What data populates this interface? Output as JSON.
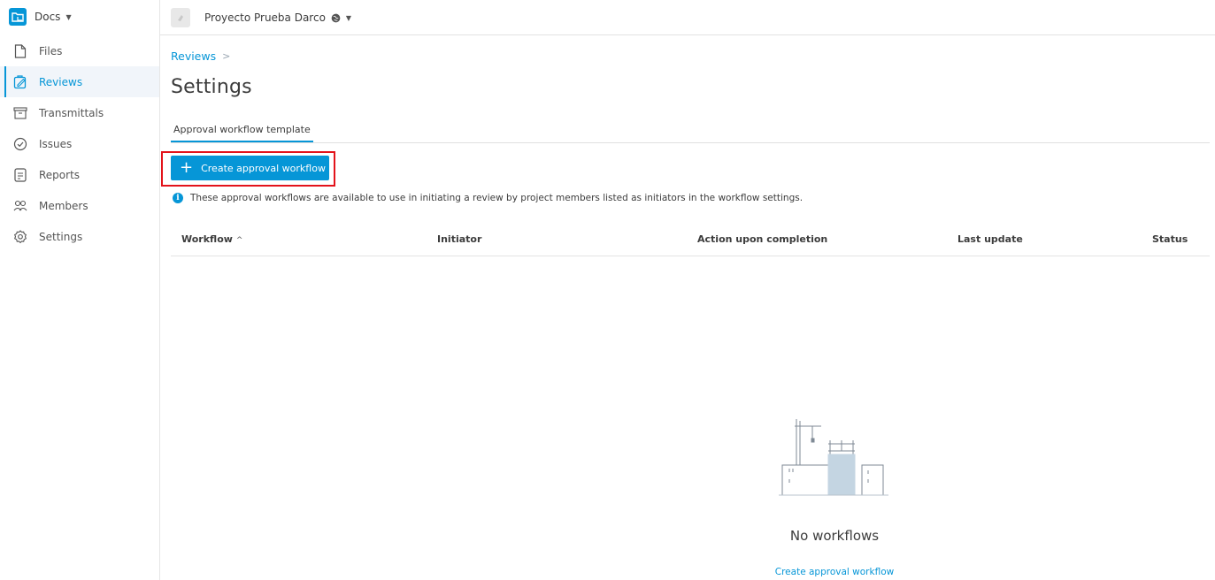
{
  "app": {
    "name": "Docs"
  },
  "project": {
    "name": "Proyecto Prueba Darco"
  },
  "sidebar": {
    "items": [
      {
        "label": "Files",
        "icon": "file-icon"
      },
      {
        "label": "Reviews",
        "icon": "reviews-icon",
        "active": true
      },
      {
        "label": "Transmittals",
        "icon": "transmittals-icon"
      },
      {
        "label": "Issues",
        "icon": "issues-icon"
      },
      {
        "label": "Reports",
        "icon": "reports-icon"
      },
      {
        "label": "Members",
        "icon": "members-icon"
      },
      {
        "label": "Settings",
        "icon": "settings-icon"
      }
    ]
  },
  "breadcrumb": {
    "parent": "Reviews",
    "separator": ">"
  },
  "page": {
    "title": "Settings"
  },
  "tabs": [
    {
      "label": "Approval workflow template",
      "active": true
    }
  ],
  "toolbar": {
    "create_label": "Create approval workflow"
  },
  "info": {
    "text": "These approval workflows are available to use in initiating a review by project members listed as initiators in the workflow settings."
  },
  "table": {
    "columns": [
      "Workflow",
      "Initiator",
      "Action upon completion",
      "Last update",
      "Status"
    ],
    "sort_indicator": "^",
    "rows": []
  },
  "empty_state": {
    "title": "No workflows",
    "link": "Create approval workflow"
  },
  "colors": {
    "accent": "#0696d7",
    "highlight": "#e3131b"
  }
}
